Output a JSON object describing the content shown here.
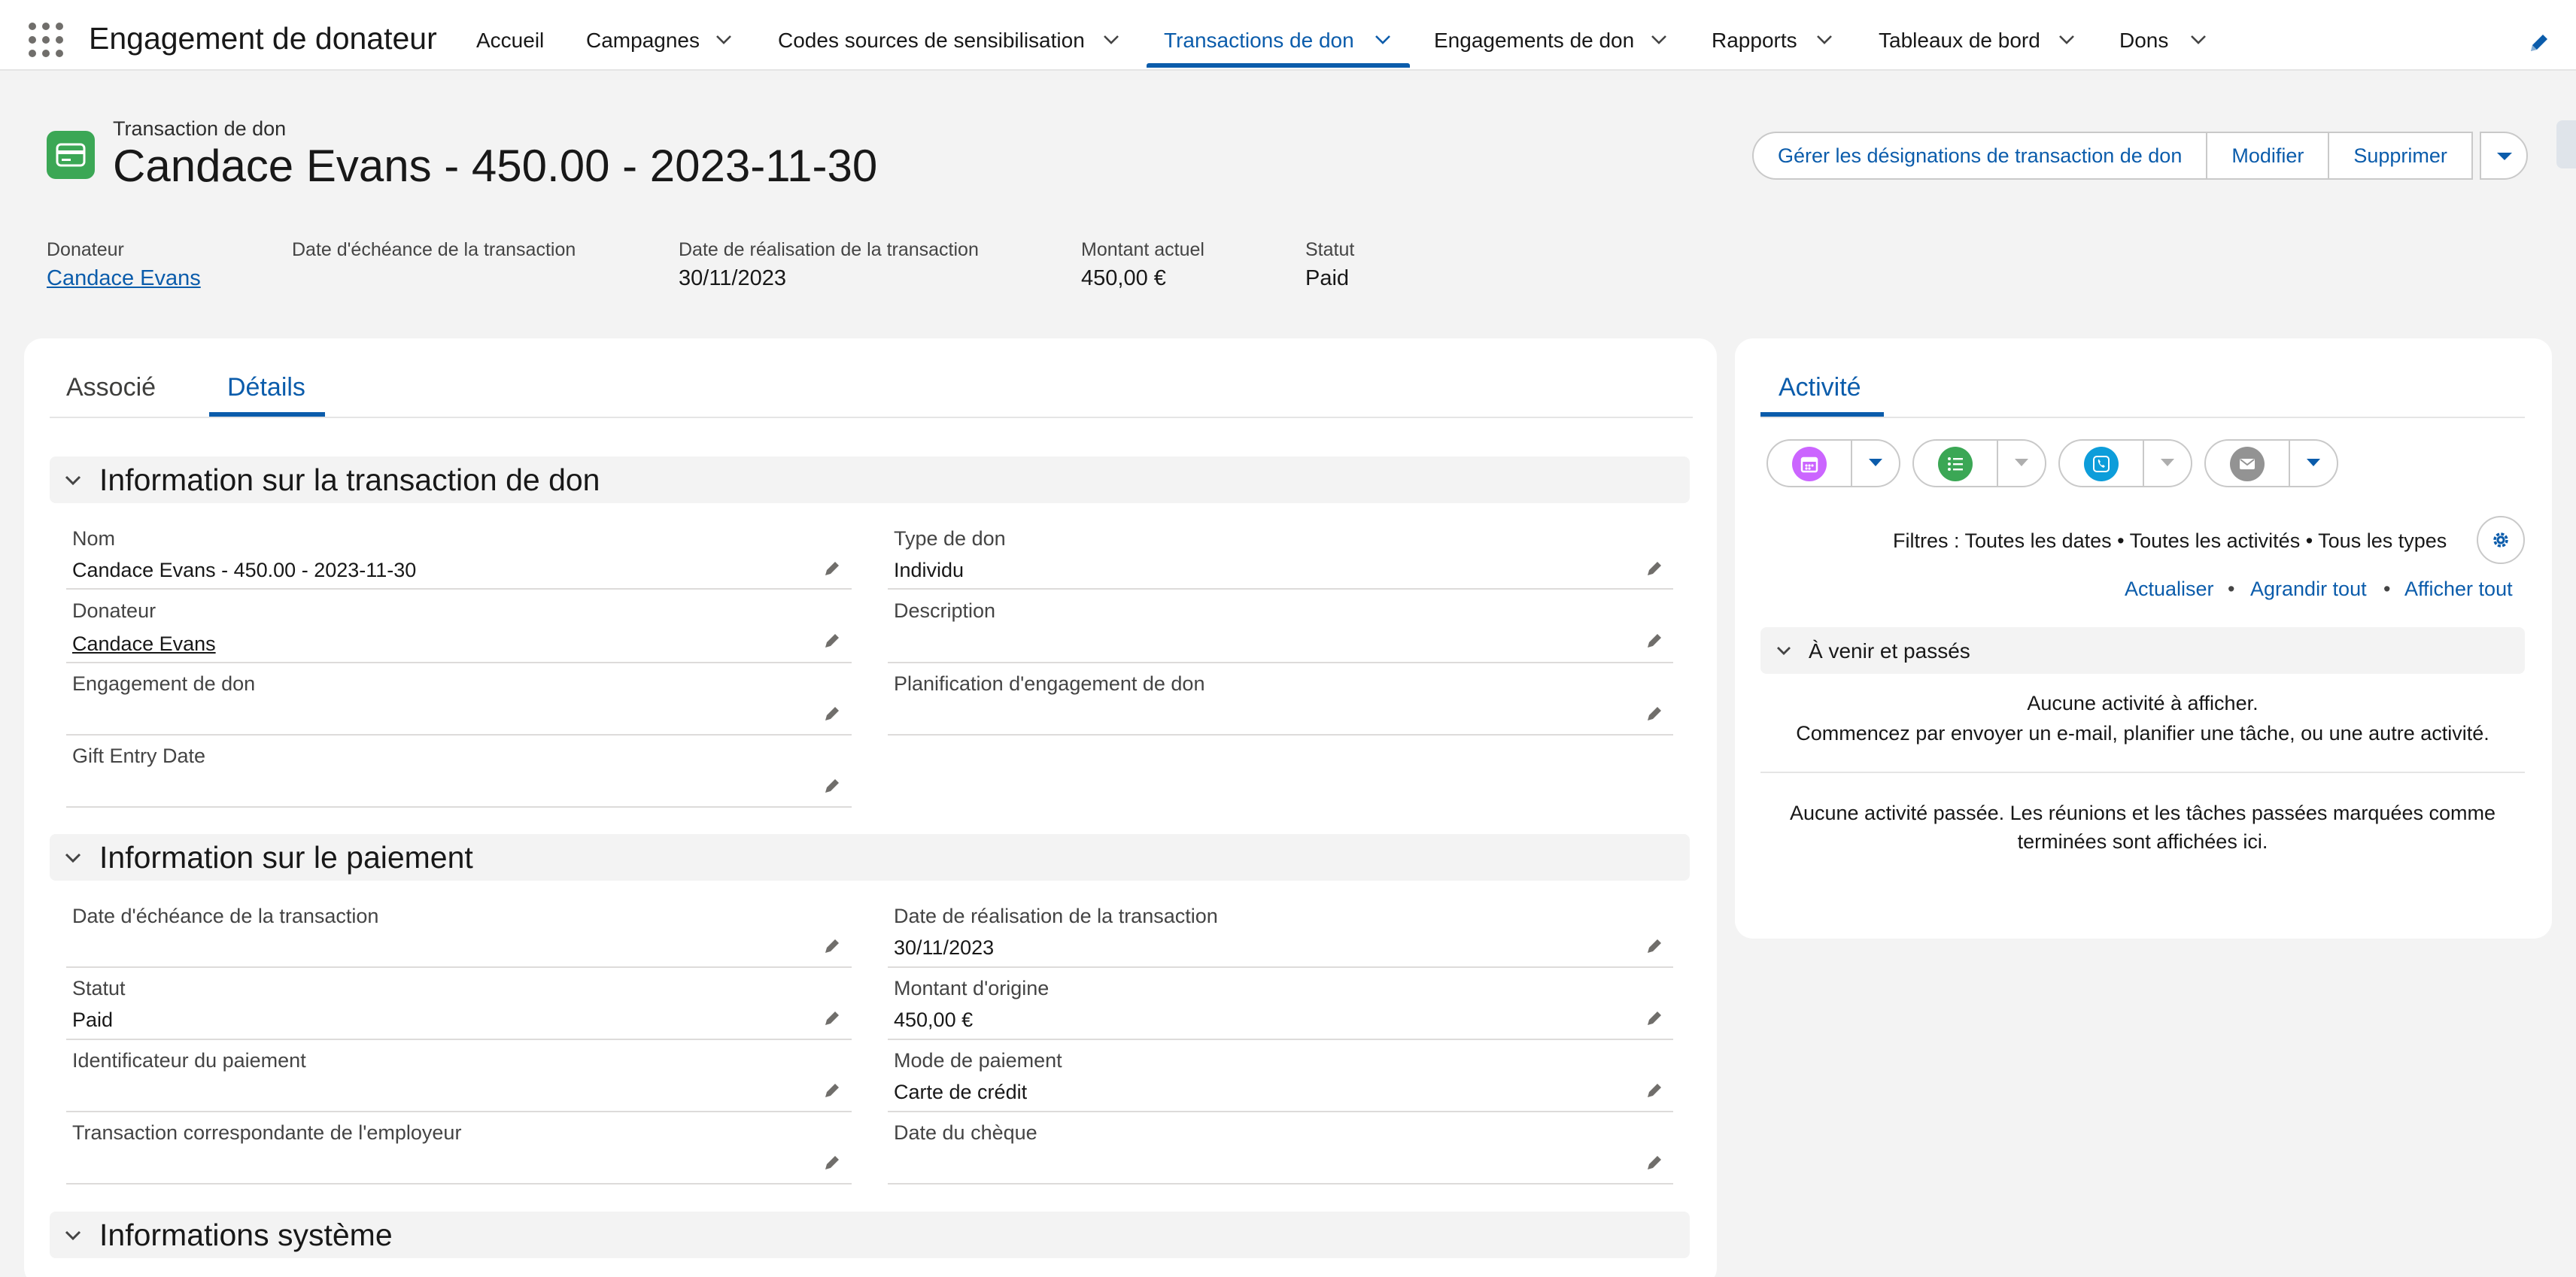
{
  "nav": {
    "app_name": "Engagement de donateur",
    "items": [
      {
        "label": "Accueil"
      },
      {
        "label": "Campagnes"
      },
      {
        "label": "Codes sources de sensibilisation"
      },
      {
        "label": "Transactions de don"
      },
      {
        "label": "Engagements de don"
      },
      {
        "label": "Rapports"
      },
      {
        "label": "Tableaux de bord"
      },
      {
        "label": "Dons"
      }
    ],
    "active_item": "Transactions de don"
  },
  "record": {
    "object_type": "Transaction de don",
    "title": "Candace Evans - 450.00 - 2023-11-30",
    "icon": "credit-card-icon",
    "actions": {
      "manage_designations": "Gérer les désignations de transaction de don",
      "edit": "Modifier",
      "delete": "Supprimer"
    },
    "highlights": [
      {
        "label": "Donateur",
        "value": "Candace Evans"
      },
      {
        "label": "Date d'échéance de la transaction",
        "value": ""
      },
      {
        "label": "Date de réalisation de la transaction",
        "value": "30/11/2023"
      },
      {
        "label": "Montant actuel",
        "value": "450,00 €"
      },
      {
        "label": "Statut",
        "value": "Paid"
      }
    ]
  },
  "tabs": {
    "related": "Associé",
    "details": "Détails",
    "active": "Détails"
  },
  "sections": {
    "transaction": {
      "title": "Information sur la transaction de don",
      "fields": {
        "nom": {
          "label": "Nom",
          "value": "Candace Evans - 450.00 - 2023-11-30"
        },
        "type_don": {
          "label": "Type de don",
          "value": "Individu"
        },
        "donateur": {
          "label": "Donateur",
          "value": "Candace Evans"
        },
        "description": {
          "label": "Description",
          "value": ""
        },
        "engagement": {
          "label": "Engagement de don",
          "value": ""
        },
        "planification": {
          "label": "Planification d'engagement de don",
          "value": ""
        },
        "gift_entry_date": {
          "label": "Gift Entry Date",
          "value": ""
        }
      }
    },
    "payment": {
      "title": "Information sur le paiement",
      "fields": {
        "date_echeance": {
          "label": "Date d'échéance de la transaction",
          "value": ""
        },
        "date_realisation": {
          "label": "Date de réalisation de la transaction",
          "value": "30/11/2023"
        },
        "statut": {
          "label": "Statut",
          "value": "Paid"
        },
        "montant_origine": {
          "label": "Montant d'origine",
          "value": "450,00 €"
        },
        "identificateur": {
          "label": "Identificateur du paiement",
          "value": ""
        },
        "mode_paiement": {
          "label": "Mode de paiement",
          "value": "Carte de crédit"
        },
        "employeur": {
          "label": "Transaction correspondante de l'employeur",
          "value": ""
        },
        "date_cheque": {
          "label": "Date du chèque",
          "value": ""
        }
      }
    },
    "system": {
      "title": "Informations système"
    }
  },
  "activity": {
    "tab": "Activité",
    "filters": "Filtres : Toutes les dates • Toutes les activités • Tous les types",
    "links": {
      "refresh": "Actualiser",
      "expand_all": "Agrandir tout",
      "view_all": "Afficher tout"
    },
    "upcoming_title": "À venir et passés",
    "empty_line1": "Aucune activité à afficher.",
    "empty_line2": "Commencez par envoyer un e-mail, planifier une tâche, ou une autre activité.",
    "past_line1": "Aucune activité passée. Les réunions et les tâches passées marquées comme",
    "past_line2": "terminées sont affichées ici.",
    "buttons": [
      {
        "icon": "calendar-icon",
        "color": "#cb65ff"
      },
      {
        "icon": "task-list-icon",
        "color": "#3ba755"
      },
      {
        "icon": "phone-icon",
        "color": "#0d9dda"
      },
      {
        "icon": "email-icon",
        "color": "#939393"
      }
    ]
  },
  "colors": {
    "brand": "#0b5cab",
    "record_icon": "#3ba755"
  }
}
